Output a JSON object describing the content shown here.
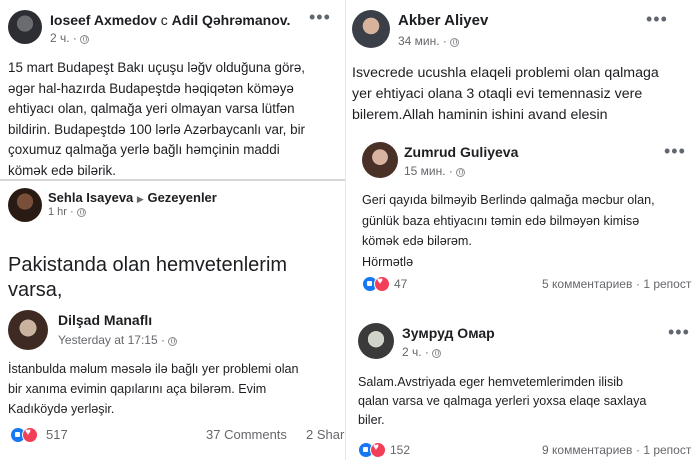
{
  "left_top": {
    "author": "Ioseef Axmedov",
    "with_word": "с",
    "tagged": "Adil Qəhrəmanov",
    "time": "2 ч. ·",
    "text": "15 mart Budapeşt Bakı uçuşu ləğv olduğuna görə,\nəgər hal-hazırda Budapeştdə həqiqətən köməyə\nehtiyacı olan, qalmağa yeri olmayan varsa lütfən\nbildirin. Budapeştdə 100 lərlə Azərbaycanlı var, bir\nçoxumuz qalmağa yerlə bağlı həmçinin maddi\nkömək edə bilərik."
  },
  "left_mid": {
    "author": "Sehla Isayeva",
    "arrow": "▶",
    "group": "Gezeyenler",
    "time": "1 hr ·",
    "text": "Pakistanda olan hemvetenlerim varsa,\ngetmeye yerleri yoxsa bizde qala\nbilerler",
    "emoji": "😊"
  },
  "left_bottom": {
    "author": "Dilşad Manaflı",
    "time": "Yesterday at 17:15 ·",
    "text": "İstanbulda məlum məsələ ilə bağlı yer problemi olan\nbir xanıma evimin qapılarını aça bilərəm. Evim\nKadıköydə yerləşir.",
    "reactions": "517",
    "comments": "37 Comments",
    "shares": "2 Shar"
  },
  "right_top": {
    "author": "Akber Aliyev",
    "time": "34 мин. ·",
    "text": "Isvecrede ucushla elaqeli problemi olan qalmaga\nyer ehtiyaci olana 3 otaqli evi temennasiz vere\nbilerem.Allah haminin ishini avand elesin"
  },
  "right_mid": {
    "author": "Zumrud Guliyeva",
    "time": "15 мин. ·",
    "text": "Geri qayıda bilməyib Berlində qalmağa məcbur olan,\ngünlük baza ehtiyacını təmin edə bilməyən kimisə\nkömək edə bilərəm.\nHörmətlə",
    "reactions": "47",
    "comments": "5 комментариев",
    "shares": "· 1 репост"
  },
  "right_bottom": {
    "author": "Зумруд Омар",
    "time": "2 ч. ·",
    "text": "Salam.Avstriyada eger hemvetemlerimden ilisib\nqalan varsa ve qalmaga yerleri yoxsa elaqe saxlaya\nbiler.",
    "reactions": "152",
    "comments": "9 комментариев",
    "shares": "· 1 репост"
  },
  "more_label": "•••",
  "colors": {
    "like": "#1877f2",
    "love": "#f33e58",
    "meta": "#65676b"
  }
}
